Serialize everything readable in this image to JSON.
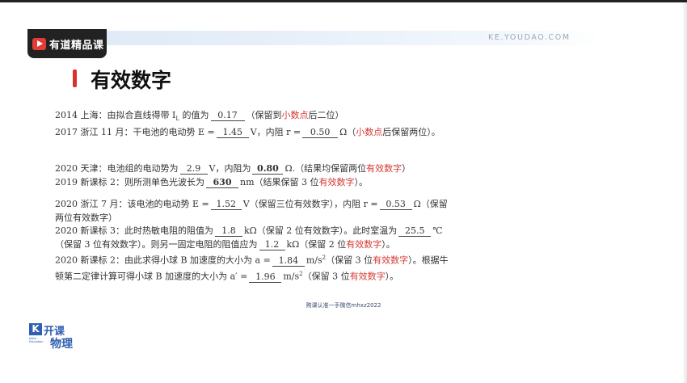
{
  "header": {
    "brand_label": "有道精品课",
    "site_url": "KE.YOUDAO.COM"
  },
  "page_title": "有效数字",
  "block1": {
    "l1_a": "2014 上海：由拟合直线得带 I",
    "l1_sub": "L",
    "l1_b": " 的值为",
    "l1_v1": "0.17",
    "l1_c": "（保留到",
    "l1_red": "小数点",
    "l1_d": "后二位）",
    "l2_a": "2017 浙江 11 月：干电池的电动势 E =",
    "l2_v1": "1.45",
    "l2_b": "V，内阻 r =",
    "l2_v2": "0.50",
    "l2_c": "Ω（",
    "l2_red": "小数点",
    "l2_d": "后保留两位）。"
  },
  "block2": {
    "l1_a": "2020 天津：电池组的电动势为",
    "l1_v1": "2.9",
    "l1_b": "V，内阻为",
    "l1_v2": "0.80",
    "l1_c": "Ω.（结果均保留两位",
    "l1_red": "有效数字",
    "l1_d": "）",
    "l2_a": "2019 新课标 2：则所测单色光波长为",
    "l2_v1": "630",
    "l2_b": "nm（结果保留 3 位",
    "l2_red": "有效数字",
    "l2_c": "）。"
  },
  "block3": {
    "l1_a": "2020 浙江 7 月：该电池的电动势 E =",
    "l1_v1": "1.52",
    "l1_b": "V（保留三位有效数字），内阻 r =",
    "l1_v2": "0.53",
    "l1_c": "Ω（保留",
    "l2_a": "两位有效数字）",
    "l3_a": "2020 新课标 3：此时热敏电阻的阻值为",
    "l3_v1": "1.8",
    "l3_b": "kΩ（保留 2 位有效数字）。此时室温为",
    "l3_v2": "25.5",
    "l3_c": "℃",
    "l4_a": "（保留 3 位有效数字）。则另一固定电阻的阻值应为",
    "l4_v1": "1.2",
    "l4_b": "kΩ（保留 2 位",
    "l4_red": "有效数字",
    "l4_c": "）。",
    "l5_a": "2020 新课标 2：由此求得小球 B 加速度的大小为 a =",
    "l5_v1": "1.84",
    "l5_b": "m/s",
    "l5_sup": "2",
    "l5_c": "（保留 3 位",
    "l5_red": "有效数字",
    "l5_d": "）。根据牛",
    "l6_a": "顿第二定律计算可得小球 B 加速度的大小为 a′ =",
    "l6_v1": "1.96",
    "l6_b": "m/s",
    "l6_sup": "2",
    "l6_c": "（保留 3 位",
    "l6_red": "有效数字",
    "l6_d": "）。"
  },
  "watermark": "购课认准一手微信mhxz2022",
  "footer_logo": {
    "k_letter": "K",
    "top_text": "开课",
    "small_text": "Kaike Education",
    "bottom_text": "物理"
  },
  "colors": {
    "accent_red": "#d43a33",
    "brand_dark": "#222222",
    "logo_blue": "#2f5fb0"
  }
}
